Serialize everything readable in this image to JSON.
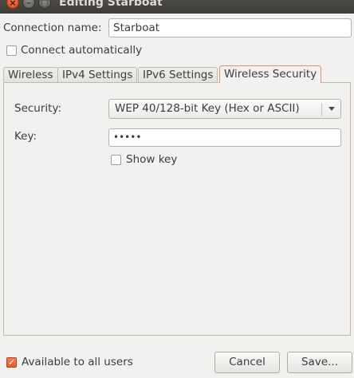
{
  "window": {
    "title": "Editing Starboat",
    "close_glyph": "×",
    "minimize_glyph": "–",
    "maximize_glyph": "□"
  },
  "connection": {
    "label": "Connection name:",
    "value": "Starboat",
    "auto_connect_label": "Connect automatically",
    "auto_connect_checked": false
  },
  "tabs": [
    {
      "label": "Wireless",
      "active": false
    },
    {
      "label": "IPv4 Settings",
      "active": false
    },
    {
      "label": "IPv6 Settings",
      "active": false
    },
    {
      "label": "Wireless Security",
      "active": true
    }
  ],
  "security": {
    "label": "Security:",
    "selected": "WEP 40/128-bit Key (Hex or ASCII)",
    "key_label": "Key:",
    "key_value": "•••••",
    "show_key_label": "Show key",
    "show_key_checked": false
  },
  "footer": {
    "available_label": "Available to all users",
    "available_checked": true,
    "check_glyph": "✓",
    "cancel_label": "Cancel",
    "save_label": "Save..."
  },
  "colors": {
    "accent": "#e35b2a",
    "titlebar": "#3c3b37",
    "background": "#f2f1f0"
  }
}
